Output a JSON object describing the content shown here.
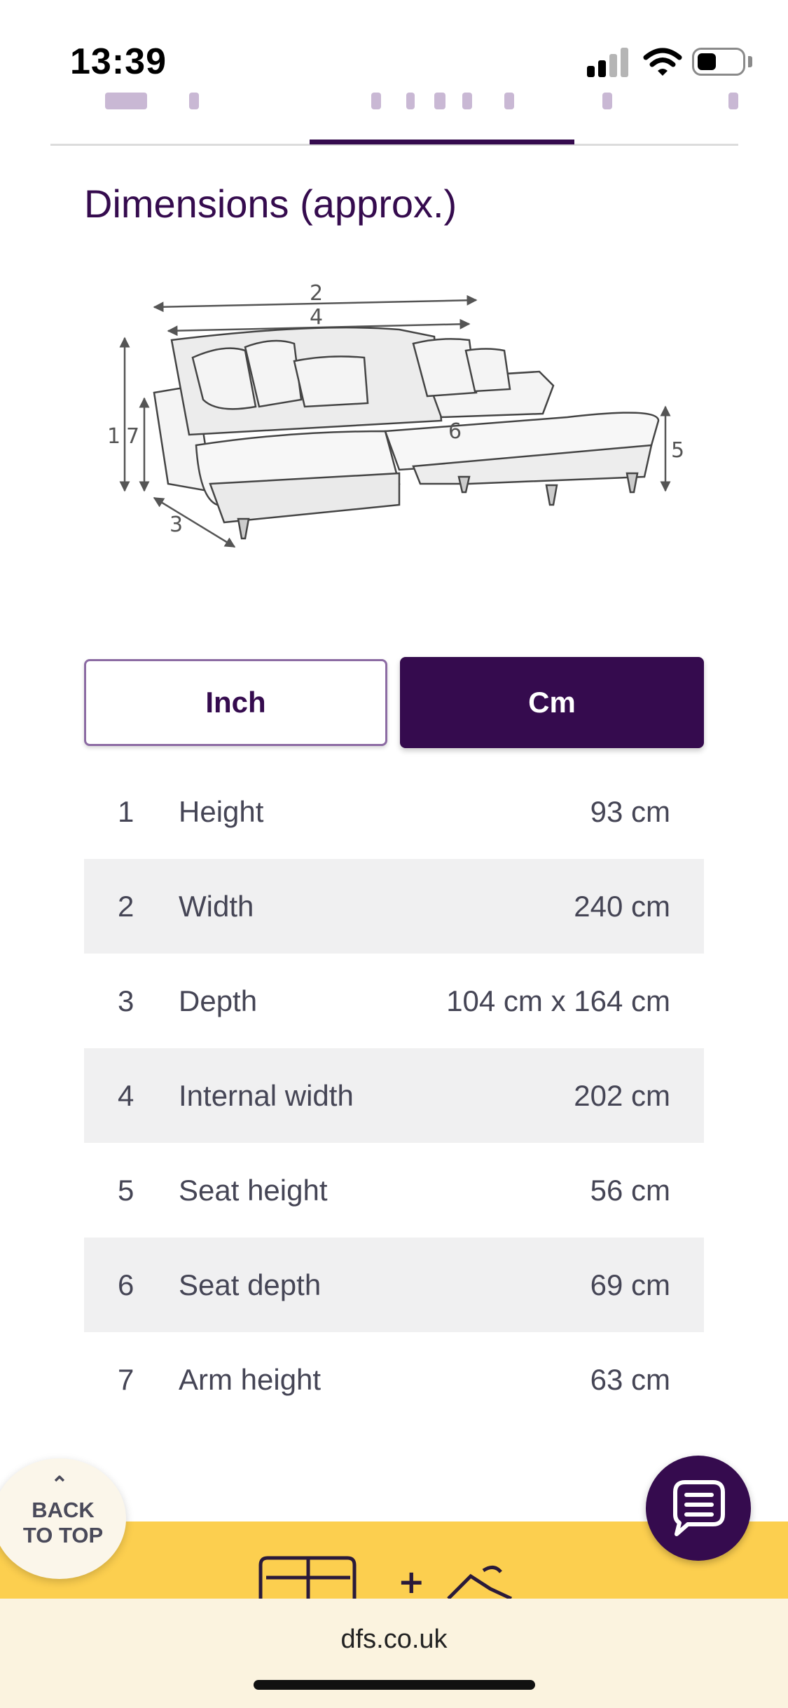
{
  "status_bar": {
    "time": "13:39"
  },
  "section": {
    "title": "Dimensions (approx.)"
  },
  "diagram": {
    "callouts": [
      "2",
      "4",
      "1",
      "7",
      "6",
      "5",
      "3"
    ]
  },
  "unit_toggle": {
    "inch_label": "Inch",
    "cm_label": "Cm",
    "selected": "Cm"
  },
  "dimensions": [
    {
      "num": "1",
      "label": "Height",
      "value": "93 cm"
    },
    {
      "num": "2",
      "label": "Width",
      "value": "240 cm"
    },
    {
      "num": "3",
      "label": "Depth",
      "value": "104 cm x 164 cm"
    },
    {
      "num": "4",
      "label": "Internal width",
      "value": "202 cm"
    },
    {
      "num": "5",
      "label": "Seat height",
      "value": "56 cm"
    },
    {
      "num": "6",
      "label": "Seat depth",
      "value": "69 cm"
    },
    {
      "num": "7",
      "label": "Arm height",
      "value": "63 cm"
    }
  ],
  "back_to_top": {
    "line1": "BACK",
    "line2": "TO TOP"
  },
  "browser": {
    "url": "dfs.co.uk"
  },
  "colors": {
    "brand": "#350b4e",
    "banner": "#fccf4f",
    "url_bar": "#fbf3df"
  }
}
